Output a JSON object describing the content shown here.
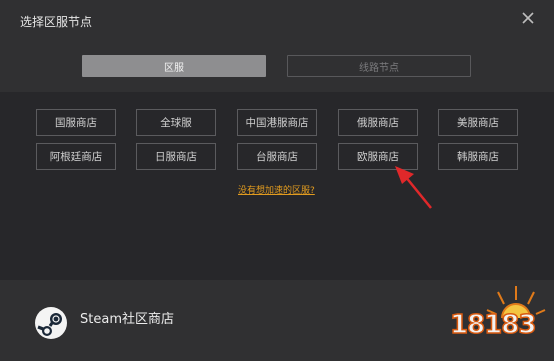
{
  "dialog": {
    "title": "选择区服节点",
    "close_icon": "close-icon"
  },
  "tabs": {
    "active_label": "区服",
    "inactive_label": "线路节点"
  },
  "regions": {
    "row1": [
      "国服商店",
      "全球服",
      "中国港服商店",
      "俄服商店",
      "美服商店"
    ],
    "row2": [
      "阿根廷商店",
      "日服商店",
      "台服商店",
      "欧服商店",
      "韩服商店"
    ]
  },
  "help_link": "没有想加速的区服?",
  "footer": {
    "label": "Steam社区商店",
    "icon": "steam-logo-icon"
  },
  "watermark": {
    "text": "18183"
  },
  "colors": {
    "background": "#2b2b2d",
    "link": "#e19b1f",
    "arrow": "#e0282a"
  }
}
